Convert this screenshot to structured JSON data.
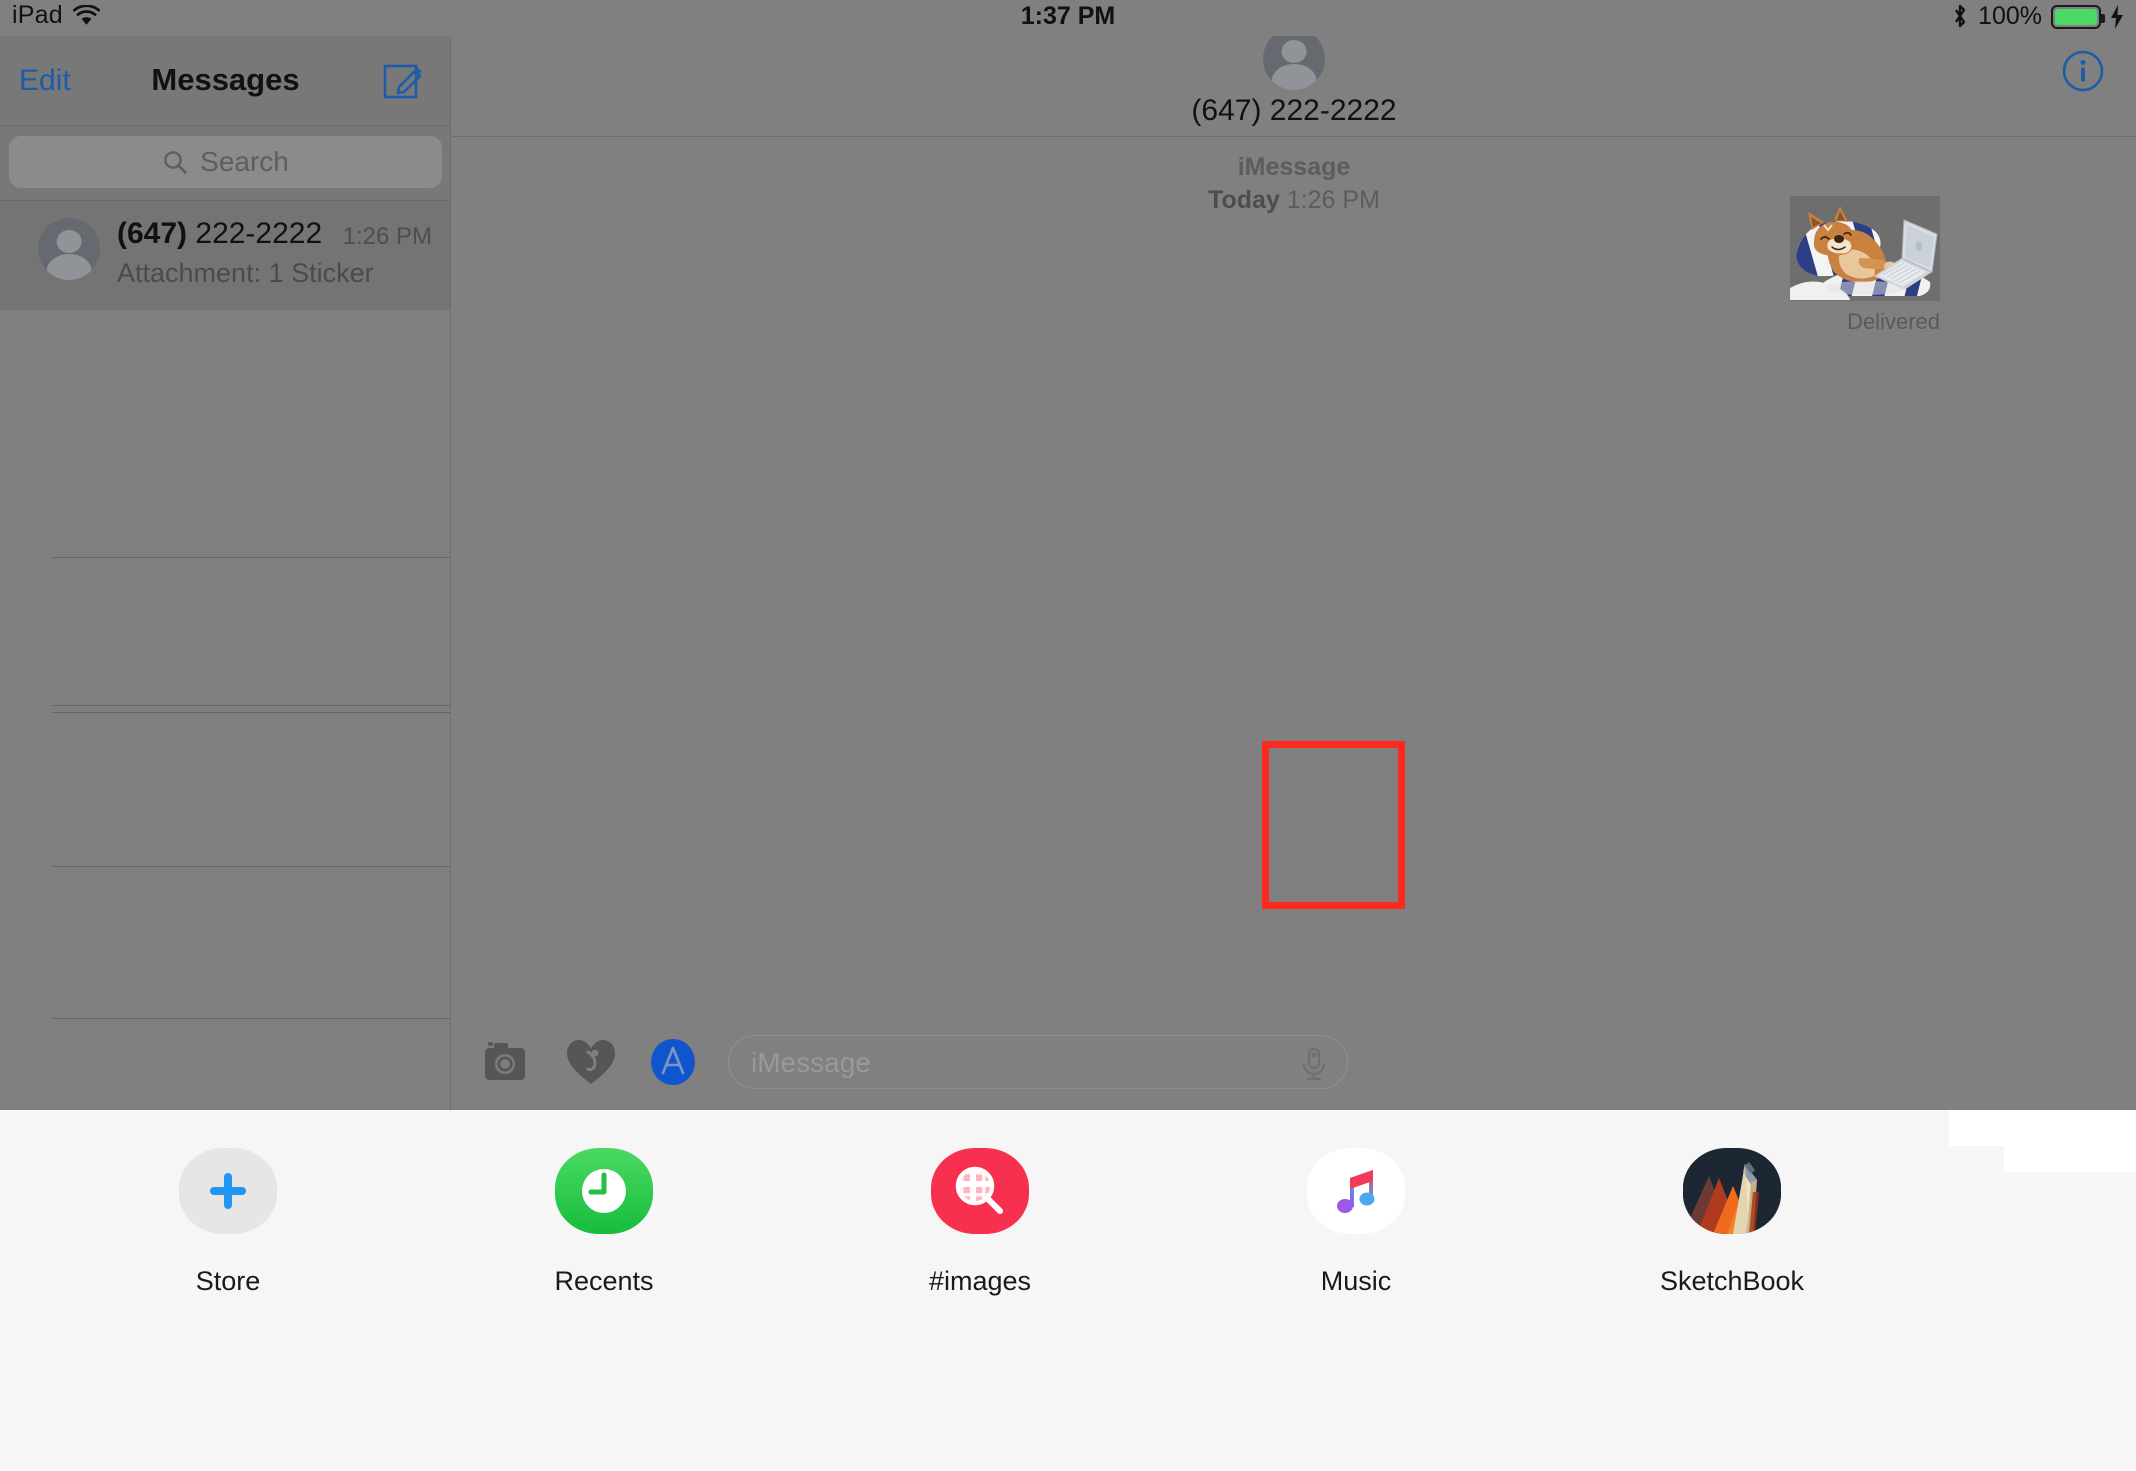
{
  "status_bar": {
    "device": "iPad",
    "wifi_icon": "wifi-icon",
    "time": "1:37 PM",
    "bluetooth_icon": "bluetooth-icon",
    "battery_percent": "100%",
    "battery_icon": "battery-full-icon",
    "charging_icon": "lightning-bolt-icon",
    "battery_color": "#4cd964"
  },
  "sidebar": {
    "edit_label": "Edit",
    "title": "Messages",
    "compose_icon": "compose-icon",
    "accent_color": "#1c5ca8",
    "search": {
      "placeholder": "Search",
      "icon": "search-icon"
    },
    "conversations": [
      {
        "avatar_icon": "person-placeholder-avatar",
        "name_bold": "(647)",
        "name_rest": " 222-2222",
        "time": "1:26 PM",
        "preview": "Attachment: 1 Sticker",
        "selected": true
      }
    ],
    "empty_row_count": 4
  },
  "thread": {
    "avatar_icon": "person-placeholder-avatar",
    "contact": "(647) 222-2222",
    "info_icon": "info-circle-icon",
    "service": "iMessage",
    "date_bold": "Today",
    "date_time": " 1:26 PM",
    "message": {
      "type": "sticker",
      "sticker_description": "cartoon shiba dog lying on blue and white striped pillows using a laptop",
      "delivery_status": "Delivered"
    }
  },
  "input_bar": {
    "camera_icon": "camera-icon",
    "digital_touch_icon": "digital-touch-heart-icon",
    "app_store_icon": "app-store-icon",
    "app_store_color": "#1155cc",
    "placeholder": "iMessage",
    "mic_icon": "microphone-icon"
  },
  "app_drawer": {
    "apps": [
      {
        "label": "Store",
        "icon": "plus-icon",
        "bg": "#e6e6e6",
        "selected": false
      },
      {
        "label": "Recents",
        "icon": "clock-icon",
        "bg": "#2ecc4e",
        "selected": false
      },
      {
        "label": "#images",
        "icon": "image-search-icon",
        "bg": "#f8304f",
        "selected": false
      },
      {
        "label": "Music",
        "icon": "music-note-icon",
        "bg": "#ffffff",
        "selected": false
      },
      {
        "label": "SketchBook",
        "icon": "sketchbook-pencil-icon",
        "bg": "#1d2733",
        "selected": true
      }
    ],
    "highlight_color": "#ff2a1f"
  }
}
